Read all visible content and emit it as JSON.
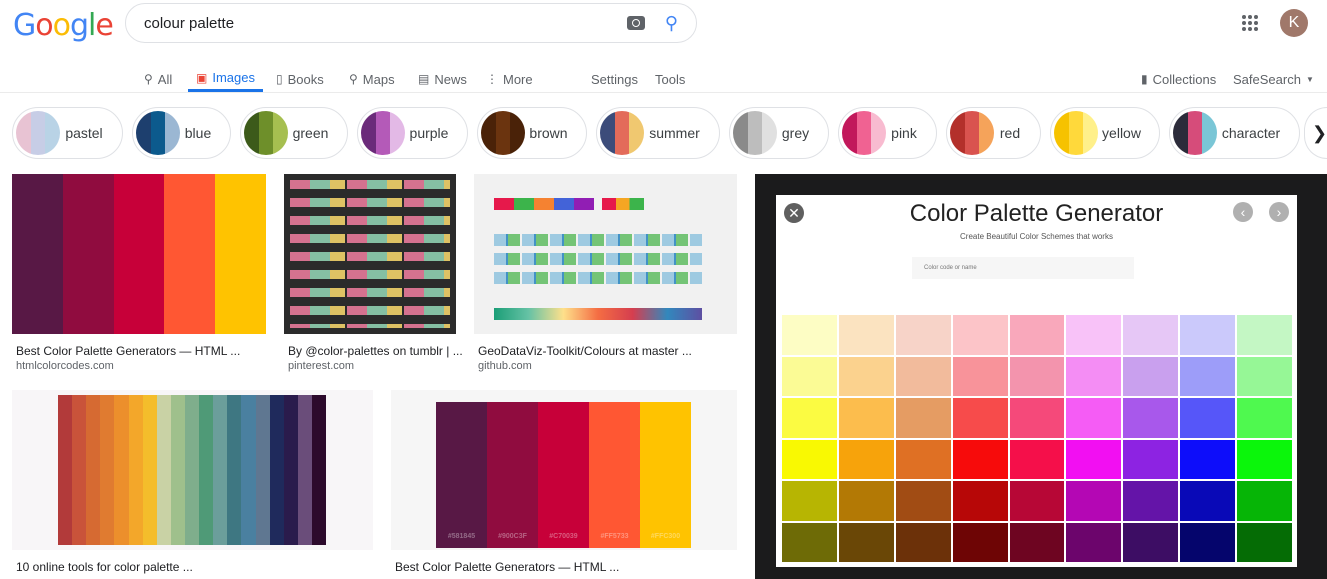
{
  "header": {
    "logo": "Google",
    "query": "colour palette",
    "avatar_letter": "K"
  },
  "tabs": [
    {
      "label": "All",
      "icon": "search-icon"
    },
    {
      "label": "Images",
      "icon": "image-icon",
      "active": true
    },
    {
      "label": "Books",
      "icon": "book-icon"
    },
    {
      "label": "Maps",
      "icon": "pin-icon"
    },
    {
      "label": "News",
      "icon": "news-icon"
    },
    {
      "label": "More",
      "icon": "dots-icon"
    }
  ],
  "tools": {
    "settings": "Settings",
    "tools": "Tools",
    "collections": "Collections",
    "safesearch": "SafeSearch"
  },
  "chips": [
    {
      "label": "pastel",
      "colors": [
        "#e8c3d3",
        "#c7cde6",
        "#b9d3e6"
      ]
    },
    {
      "label": "blue",
      "colors": [
        "#1d3f6e",
        "#0c5a8d",
        "#9bb7d3"
      ]
    },
    {
      "label": "green",
      "colors": [
        "#3c5a1a",
        "#6e8f2a",
        "#a6bf50"
      ]
    },
    {
      "label": "purple",
      "colors": [
        "#6b2b7a",
        "#b45ab8",
        "#e3b9e6"
      ]
    },
    {
      "label": "brown",
      "colors": [
        "#4a2208",
        "#6b340f",
        "#4a2208"
      ]
    },
    {
      "label": "summer",
      "colors": [
        "#3c4c7a",
        "#e36b5a",
        "#f0c870"
      ]
    },
    {
      "label": "grey",
      "colors": [
        "#8a8a8a",
        "#bdbdbd",
        "#e0e0e0"
      ]
    },
    {
      "label": "pink",
      "colors": [
        "#c2185b",
        "#f06292",
        "#f8bbd0"
      ]
    },
    {
      "label": "red",
      "colors": [
        "#b3302b",
        "#d9534f",
        "#f5a35a"
      ]
    },
    {
      "label": "yellow",
      "colors": [
        "#f6c200",
        "#ffd93b",
        "#fff08a"
      ]
    },
    {
      "label": "character",
      "colors": [
        "#2b2b3a",
        "#d64c7a",
        "#7ac6d6"
      ]
    }
  ],
  "results": [
    {
      "title": "Best Color Palette Generators — HTML ...",
      "source": "htmlcolorcodes.com",
      "colors": [
        "#581845",
        "#900C3F",
        "#C70039",
        "#FF5733",
        "#FFC300"
      ]
    },
    {
      "title": "By @color-palettes on tumblr | ...",
      "source": "pinterest.com"
    },
    {
      "title": "GeoDataViz-Toolkit/Colours at master ...",
      "source": "github.com"
    },
    {
      "title": "10 online tools for color palette ...",
      "colors": [
        "#b23a3a",
        "#c9533a",
        "#d66a32",
        "#e07b30",
        "#ec8f2c",
        "#f3a72a",
        "#f4bd2b",
        "#c9d2a5",
        "#9fc08c",
        "#7fae8c",
        "#4f9a77",
        "#6b9e9b",
        "#3e7782",
        "#4a80a0",
        "#5f7791",
        "#1f2a5c",
        "#2a1b4c",
        "#6a4d7a",
        "#2c0a2c"
      ]
    },
    {
      "title": "Best Color Palette Generators — HTML ...",
      "colors": [
        "#581845",
        "#900C3F",
        "#C70039",
        "#FF5733",
        "#FFC300"
      ],
      "codes": [
        "#581845",
        "#900C3F",
        "#C70039",
        "#FF5733",
        "#FFC300"
      ]
    }
  ],
  "preview": {
    "title": "Color Palette Generator",
    "subtitle": "Create Beautiful Color Schemes that works",
    "input_placeholder": "Color code or name",
    "grid": [
      [
        "#fdfdc4",
        "#fbe3c0",
        "#f7d3c8",
        "#fcc4c8",
        "#f9a8bb",
        "#f8c2f8",
        "#e6c7f6",
        "#cbc9fb",
        "#c4f7c4"
      ],
      [
        "#fbfb95",
        "#fbd28e",
        "#f2bb9c",
        "#f8939a",
        "#f394ad",
        "#f48df4",
        "#c9a0ee",
        "#9d9df9",
        "#96f796"
      ],
      [
        "#fbfb42",
        "#fcbd4d",
        "#e59c63",
        "#f74b4b",
        "#f5497a",
        "#f55cf5",
        "#a858eb",
        "#5656f9",
        "#4ff94f"
      ],
      [
        "#f9f902",
        "#f7a30b",
        "#df7024",
        "#f70b0b",
        "#f50f4a",
        "#f20ff2",
        "#8d23e2",
        "#0d0dfa",
        "#0bf60b"
      ],
      [
        "#b7b502",
        "#b37905",
        "#a14c14",
        "#b70707",
        "#b70736",
        "#b407b4",
        "#6414a8",
        "#0909b7",
        "#06b506"
      ],
      [
        "#6e6b06",
        "#6a4706",
        "#6c3109",
        "#6e0505",
        "#6e0521",
        "#6c056c",
        "#3d0d64",
        "#05056c",
        "#056c05"
      ]
    ]
  }
}
